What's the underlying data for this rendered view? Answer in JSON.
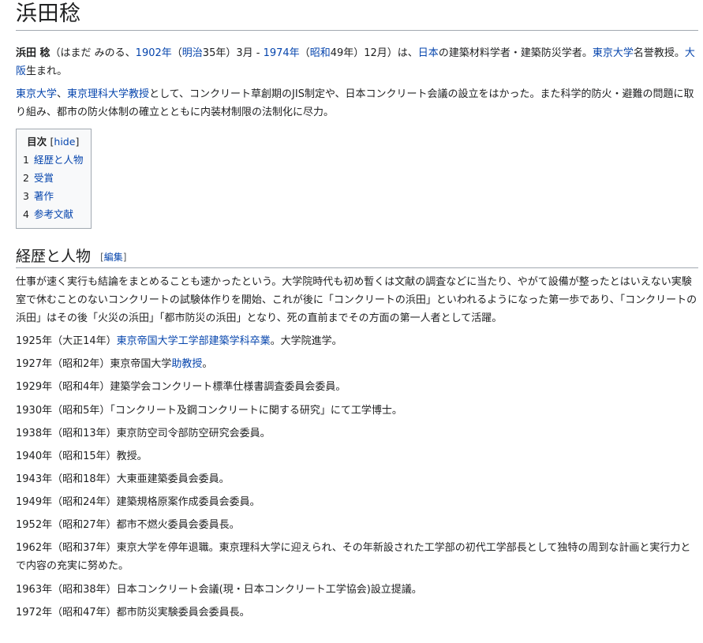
{
  "title": "浜田稔",
  "intro": {
    "name_bold": "浜田 稔",
    "t1": "（はまだ みのる、",
    "l_1902": "1902年",
    "t2": "（",
    "l_meiji": "明治",
    "t3": "35年）3月 - ",
    "l_1974": "1974年",
    "t4": "（",
    "l_showa": "昭和",
    "t5": "49年）12月）は、",
    "l_japan": "日本",
    "t6": "の建築材料学者・建築防災学者。",
    "l_todai": "東京大学",
    "t7": "名誉教授。",
    "l_osaka": "大阪",
    "t8": "生まれ。"
  },
  "para2": {
    "l_todai": "東京大学",
    "t1": "、",
    "l_rika": "東京理科大学",
    "l_kyoju": "教授",
    "t2": "として、コンクリート草創期のJIS制定や、日本コンクリート会議の設立をはかった。また科学的防火・避難の問題に取り組み、都市の防火体制の確立とともに内装材制限の法制化に尽力。"
  },
  "toc": {
    "title": "目次",
    "bracket_open": "[",
    "hide": "hide",
    "bracket_close": "]",
    "items": [
      {
        "num": "1",
        "label": "経歴と人物"
      },
      {
        "num": "2",
        "label": "受賞"
      },
      {
        "num": "3",
        "label": "著作"
      },
      {
        "num": "4",
        "label": "参考文献"
      }
    ]
  },
  "section1": {
    "heading": "経歴と人物",
    "edit_open": "[",
    "edit_label": "編集",
    "edit_close": "]",
    "para": "仕事が速く実行も結論をまとめることも速かったという。大学院時代も初め暫くは文献の調査などに当たり、やがて設備が整ったとはいえない実験室で休むことのないコンクリートの試験体作りを開始、これが後に「コンクリートの浜田」といわれるようになった第一歩であり、「コンクリートの浜田」はその後「火災の浜田」「都市防災の浜田」となり、死の直前までその方面の第一人者として活躍。"
  },
  "entries": {
    "e1925": {
      "t1": "1925年（大正14年）",
      "l1": "東京帝国大学工学部建築学科卒業",
      "t2": "。大学院進学。"
    },
    "e1927": {
      "t1": "1927年（昭和2年）東京帝国大学",
      "l1": "助教授",
      "t2": "。"
    },
    "e1929": "1929年（昭和4年）建築学会コンクリート標準仕様書調査委員会委員。",
    "e1930": "1930年（昭和5年）「コンクリート及鋼コンクリートに関する研究」にて工学博士。",
    "e1938": "1938年（昭和13年）東京防空司令部防空研究会委員。",
    "e1940": "1940年（昭和15年）教授。",
    "e1943": "1943年（昭和18年）大東亜建築委員会委員。",
    "e1949": "1949年（昭和24年）建築規格原案作成委員会委員。",
    "e1952": "1952年（昭和27年）都市不燃火委員会委員長。",
    "e1962": "1962年（昭和37年）東京大学を停年退職。東京理科大学に迎えられ、その年新設された工学部の初代工学部長として独特の周到な計画と実行力とで内容の充実に努めた。",
    "e1963": "1963年（昭和38年）日本コンクリート会議(現・日本コンクリート工学協会)設立提議。",
    "e1972": "1972年（昭和47年）都市防災実験委員会委員長。"
  },
  "colors": {
    "link": "#0645ad",
    "text": "#202122",
    "border": "#a2a9b1",
    "toc_bg": "#f8f9fa"
  }
}
